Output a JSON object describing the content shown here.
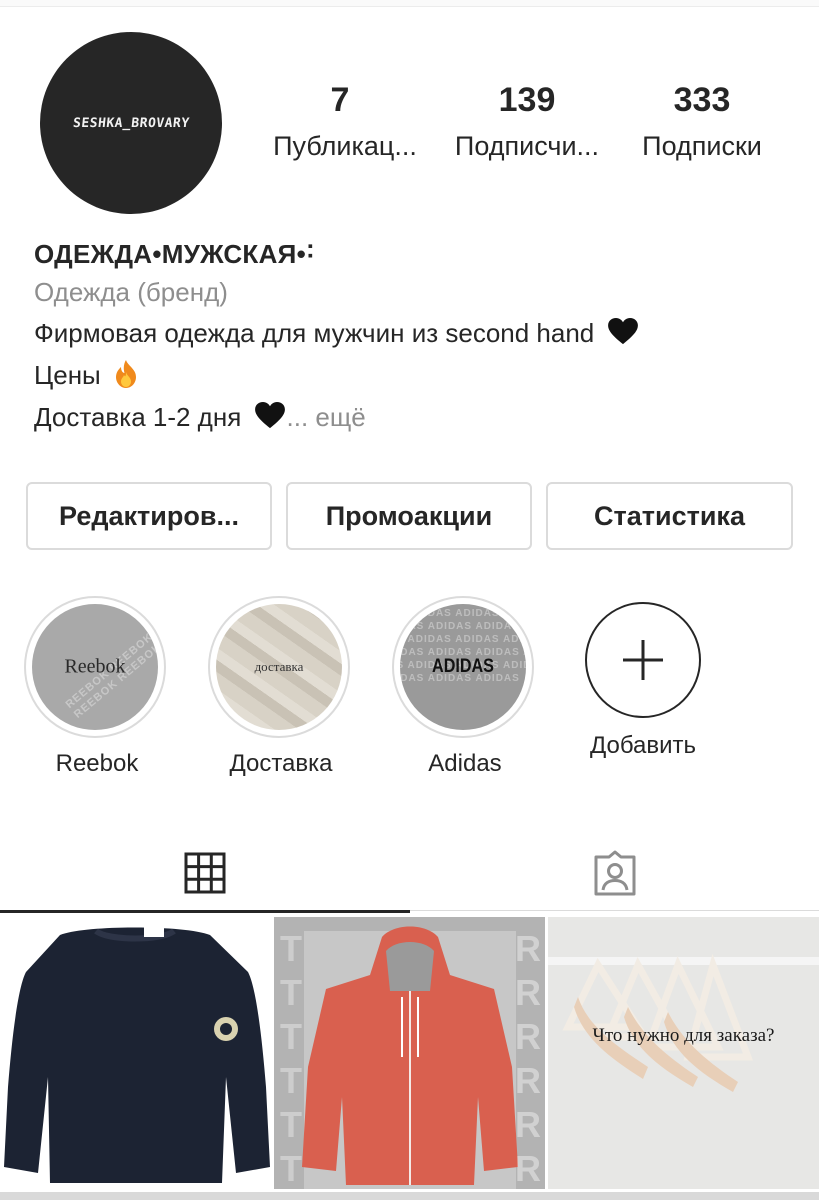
{
  "profile": {
    "avatar_text": "SESHKA_BROVARY"
  },
  "stats": [
    {
      "count": "7",
      "label": "Публикац..."
    },
    {
      "count": "139",
      "label": "Подписчи..."
    },
    {
      "count": "333",
      "label": "Подписки"
    }
  ],
  "bio": {
    "name": "ОДЕЖДА•МУЖСКАЯ•˸",
    "category": "Одежда (бренд)",
    "line1": "Фирмовая одежда для мужчин из second hand",
    "line2": "Цены",
    "line3": "Доставка 1-2 дня",
    "more": "... ещё"
  },
  "buttons": {
    "edit": "Редактиров...",
    "promo": "Промоакции",
    "stats": "Статистика"
  },
  "highlights": [
    {
      "label": "Reebok",
      "cover_text": "Reebok"
    },
    {
      "label": "Доставка",
      "cover_text": "доставка"
    },
    {
      "label": "Adidas",
      "cover_text": "ADIDAS"
    },
    {
      "label": "Добавить"
    }
  ],
  "tabs": {
    "grid_icon": "grid-icon",
    "tagged_icon": "tagged-user-icon",
    "active": "grid"
  },
  "posts": [
    {
      "caption": ""
    },
    {
      "caption": ""
    },
    {
      "caption": "Что нужно для заказа?"
    }
  ],
  "colors": {
    "text": "#262626",
    "muted": "#8e8e8e",
    "border": "#dbdbdb",
    "hoodie": "#d9604f",
    "sweater": "#1c2333"
  }
}
